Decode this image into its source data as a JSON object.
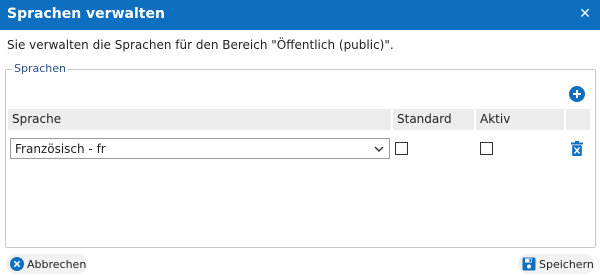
{
  "dialog": {
    "title": "Sprachen verwalten",
    "intro": "Sie verwalten die Sprachen für den Bereich \"Öffentlich (public)\"."
  },
  "fieldset": {
    "legend": "Sprachen"
  },
  "table": {
    "columns": [
      "Sprache",
      "Standard",
      "Aktiv"
    ],
    "rows": [
      {
        "sprache": "Französisch - fr",
        "standard": false,
        "aktiv": false
      }
    ]
  },
  "footer": {
    "cancel_label": "Abbrechen",
    "save_label": "Speichern"
  },
  "colors": {
    "accent": "#0e6fc1",
    "legend": "#2a4f8a",
    "header_bg": "#ececec"
  },
  "icons": {
    "close": "close-icon",
    "add": "plus-circle-icon",
    "dropdown": "chevron-down-icon",
    "delete": "trash-icon",
    "cancel": "cancel-circle-icon",
    "save": "floppy-disk-icon"
  }
}
